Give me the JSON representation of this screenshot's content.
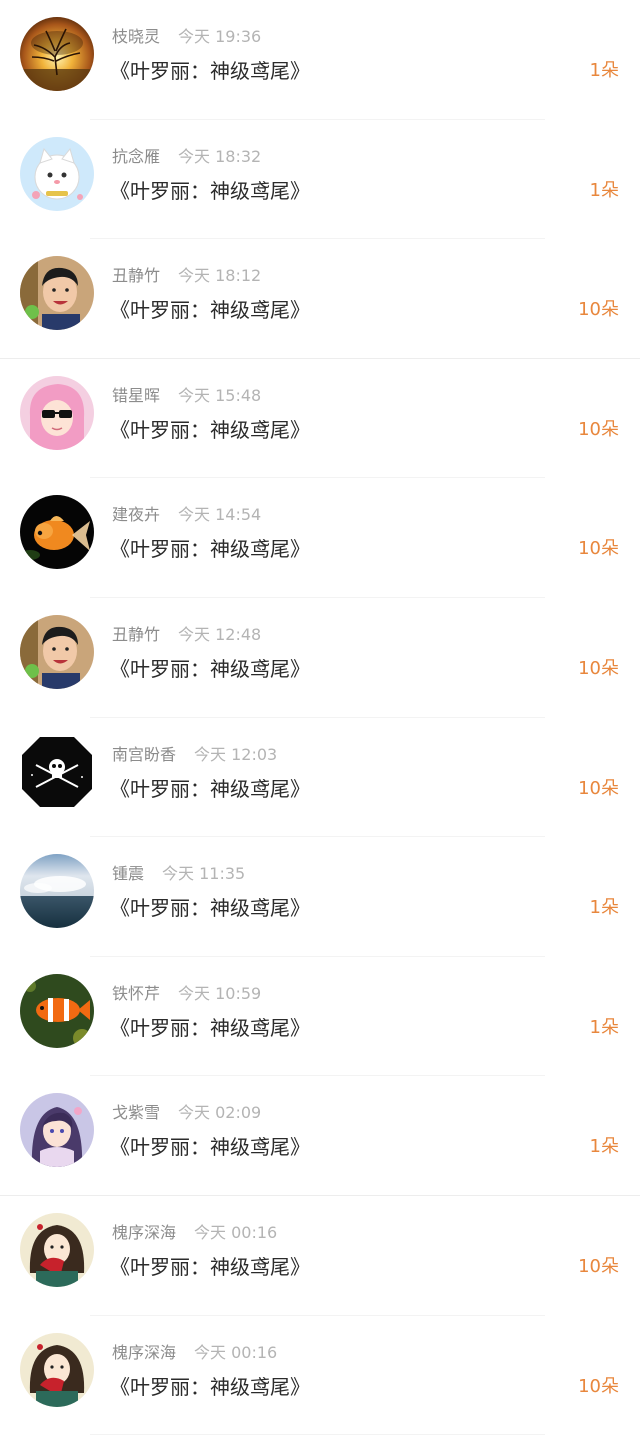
{
  "gift_list": {
    "items": [
      {
        "avatar_icon": "avatar-sunset-tree",
        "name": "枝晓灵",
        "time": "今天 19:36",
        "title": "《叶罗丽：神级鸢尾》",
        "count": "1朵"
      },
      {
        "avatar_icon": "avatar-cartoon-cat",
        "name": "抗念雁",
        "time": "今天 18:32",
        "title": "《叶罗丽：神级鸢尾》",
        "count": "1朵"
      },
      {
        "avatar_icon": "avatar-man-photo",
        "name": "丑静竹",
        "time": "今天 18:12",
        "title": "《叶罗丽：神级鸢尾》",
        "count": "10朵"
      },
      {
        "avatar_icon": "avatar-pink-sunglasses",
        "name": "错星晖",
        "time": "今天 15:48",
        "title": "《叶罗丽：神级鸢尾》",
        "count": "10朵"
      },
      {
        "avatar_icon": "avatar-goldfish",
        "name": "建夜卉",
        "time": "今天 14:54",
        "title": "《叶罗丽：神级鸢尾》",
        "count": "10朵"
      },
      {
        "avatar_icon": "avatar-man-photo",
        "name": "丑静竹",
        "time": "今天 12:48",
        "title": "《叶罗丽：神级鸢尾》",
        "count": "10朵"
      },
      {
        "avatar_icon": "avatar-skull-black",
        "name": "南宫盼香",
        "time": "今天 12:03",
        "title": "《叶罗丽：神级鸢尾》",
        "count": "10朵"
      },
      {
        "avatar_icon": "avatar-ocean-sky",
        "name": "锺震",
        "time": "今天 11:35",
        "title": "《叶罗丽：神级鸢尾》",
        "count": "1朵"
      },
      {
        "avatar_icon": "avatar-clownfish",
        "name": "铁怀芹",
        "time": "今天 10:59",
        "title": "《叶罗丽：神级鸢尾》",
        "count": "1朵"
      },
      {
        "avatar_icon": "avatar-anime-girl",
        "name": "戈紫雪",
        "time": "今天 02:09",
        "title": "《叶罗丽：神级鸢尾》",
        "count": "1朵"
      },
      {
        "avatar_icon": "avatar-fan-girl",
        "name": "槐序深海",
        "time": "今天 00:16",
        "title": "《叶罗丽：神级鸢尾》",
        "count": "10朵"
      },
      {
        "avatar_icon": "avatar-fan-girl",
        "name": "槐序深海",
        "time": "今天 00:16",
        "title": "《叶罗丽：神级鸢尾》",
        "count": "10朵"
      }
    ]
  },
  "colors": {
    "count_accent": "#e8873d",
    "name_gray": "#8c8c8c",
    "time_gray": "#b4b4b4",
    "title_dark": "#2b2b2b"
  }
}
